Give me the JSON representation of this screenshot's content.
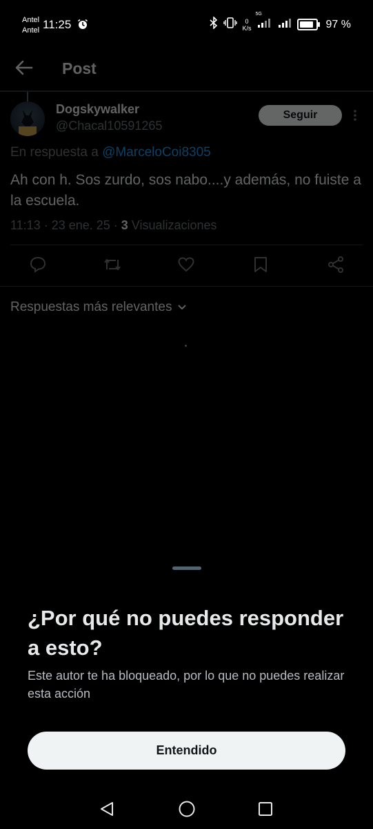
{
  "status_bar": {
    "carrier_1": "Antel",
    "carrier_2": "Antel",
    "time": "11:25",
    "net_speed_value": "0",
    "net_speed_unit": "K/s",
    "network_type": "5G",
    "battery": "97 %",
    "icons": [
      "alarm-icon",
      "bluetooth-icon",
      "vibrate-icon",
      "signal-icon",
      "signal-icon",
      "battery-icon"
    ]
  },
  "header": {
    "title": "Post",
    "back_icon": "arrow-left-icon"
  },
  "tweet": {
    "display_name": "Dogskywalker",
    "handle": "@Chacal10591265",
    "follow_label": "Seguir",
    "reply_prefix": "En respuesta a ",
    "reply_mention": "@MarceloCoi8305",
    "text": "Ah con h. Sos zurdo, sos nabo....y además, no fuiste a la escuela.",
    "timestamp": "11:13 · 23 ene. 25 · ",
    "views_count": "3",
    "views_label": " Visualizaciones",
    "actions": [
      "reply-icon",
      "retweet-icon",
      "like-icon",
      "bookmark-icon",
      "share-icon"
    ]
  },
  "replies": {
    "sort_label": "Respuestas más relevantes"
  },
  "sheet": {
    "title": "¿Por qué no puedes responder a esto?",
    "body": "Este autor te ha bloqueado, por lo que no puedes realizar esta acción",
    "button_label": "Entendido"
  },
  "navbar": {
    "icons": [
      "nav-back-icon",
      "nav-home-icon",
      "nav-recents-icon"
    ]
  }
}
